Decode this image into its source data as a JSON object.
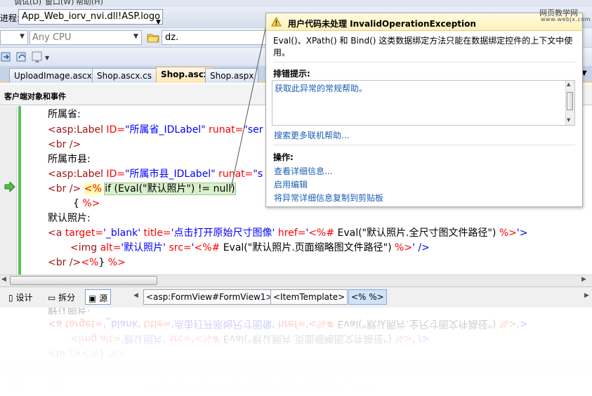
{
  "menu": {
    "items": [
      "调试(D)",
      "窗口(W)",
      "帮助(H)"
    ]
  },
  "toolbar": {
    "process_label": "进程:",
    "process_value": "App_Web_iorv_nvi.dll!ASP.logo",
    "platform_value": "Any CPU",
    "find_value": "dz."
  },
  "tabs": [
    {
      "label": "UploadImage.ascx",
      "active": false
    },
    {
      "label": "Shop.ascx.cs",
      "active": false
    },
    {
      "label": "Shop.ascx",
      "active": true
    },
    {
      "label": "Shop.aspx",
      "active": false
    }
  ],
  "object_bar": {
    "label": "客户端对象和事件"
  },
  "code": {
    "line1_text": "所属省:",
    "line2_tag": "<asp:Label",
    "line2_attr": " ID=",
    "line2_val": "\"所属省_IDLabel\"",
    "line2_attr2": " runat=",
    "line2_val2": "\"ser",
    "line3": "<br />",
    "line4_text": "所属市县:",
    "line5_tag": "<asp:Label",
    "line5_attr": " ID=",
    "line5_val": "\"所属市县_IDLabel\"",
    "line5_attr2": " runat=",
    "line5_val2": "\"s",
    "line6_br": "<br />",
    "line6_open": "<%",
    "line6_expr": "if (Eval(\"默认照片\") != null)",
    "line7_brace": "{ ",
    "line7_close": "%>",
    "line8_text": "默认照片:",
    "line9_a": "<a",
    "line9_t": " target=",
    "line9_tv": "'_blank'",
    "line9_ti": " title=",
    "line9_tiv": "'点击打开原始尺寸图像'",
    "line9_h": " href=",
    "line9_q": "'",
    "line9_open": "<%#",
    "line9_expr": " Eval(\"默认照片.全尺寸图文件路径\") ",
    "line9_close": "%>",
    "line9_end": "'>",
    "line10_img": "<img",
    "line10_alt": " alt=",
    "line10_altv": "'默认照片'",
    "line10_src": " src=",
    "line10_q": "'",
    "line10_open": "<%#",
    "line10_expr": " Eval(\"默认照片.页面缩略图文件路径\") ",
    "line10_close": "%>",
    "line10_end": "' />",
    "line11_br": "<br />",
    "line11_open": "<%",
    "line11_brace": "} ",
    "line11_close": "%>"
  },
  "bottom_bar": {
    "design_label": "设计",
    "split_label": "拆分",
    "source_label": "源",
    "breadcrumbs": [
      "<asp:FormView#FormView1>",
      "<ItemTemplate>",
      "<% %>"
    ]
  },
  "popup": {
    "title": "用户代码未处理 InvalidOperationException",
    "message": "Eval()、XPath() 和 Bind() 这类数据绑定方法只能在数据绑定控件的上下文中使用。",
    "tips_heading": "排错提示:",
    "tips_link": "获取此异常的常规帮助。",
    "search_link": "搜索更多联机帮助...",
    "actions_heading": "操作:",
    "actions": [
      "查看详细信息...",
      "启用编辑",
      "将异常详细信息复制到剪贴板"
    ]
  },
  "watermark": {
    "line1": "网页教学网",
    "line2": "www.webjx.com"
  },
  "colors": {
    "accent_tab": "#ffe7b2",
    "popup_title_bg": "#fff1b8",
    "link": "#1a5fb4",
    "changed_margin": "#56c45a"
  }
}
